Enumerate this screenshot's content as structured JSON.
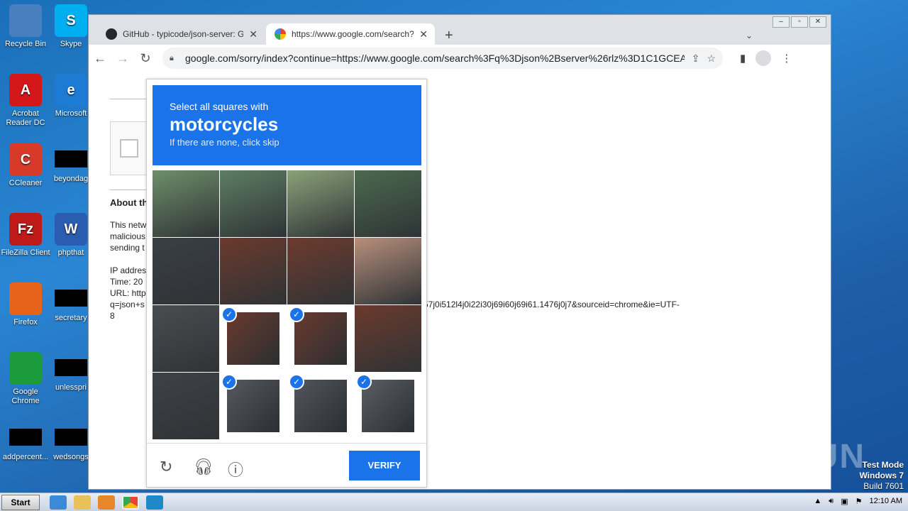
{
  "desktop": {
    "icons": [
      {
        "label": "Recycle Bin",
        "color": "#4a7fbf",
        "glyph": ""
      },
      {
        "label": "Skype",
        "color": "#00aff0",
        "glyph": "S"
      },
      {
        "label": "Acrobat Reader DC",
        "color": "#d4181a",
        "glyph": "A"
      },
      {
        "label": "Microsoft",
        "color": "#1e7bd4",
        "glyph": "e"
      },
      {
        "label": "CCleaner",
        "color": "#d83a2a",
        "glyph": "C"
      },
      {
        "label": "beyondag",
        "color": "#000000",
        "glyph": ""
      },
      {
        "label": "FileZilla Client",
        "color": "#bf1a1a",
        "glyph": "Fz"
      },
      {
        "label": "phpthat",
        "color": "#2a5db0",
        "glyph": "W"
      },
      {
        "label": "Firefox",
        "color": "#e8631a",
        "glyph": ""
      },
      {
        "label": "secretary",
        "color": "#000000",
        "glyph": ""
      },
      {
        "label": "Google Chrome",
        "color": "#1a9a3a",
        "glyph": ""
      },
      {
        "label": "unlesspri",
        "color": "#000000",
        "glyph": ""
      },
      {
        "label": "addpercent...",
        "color": "#000000",
        "glyph": ""
      },
      {
        "label": "wedsongs",
        "color": "#000000",
        "glyph": ""
      }
    ]
  },
  "browser": {
    "tabs": [
      {
        "title": "GitHub - typicode/json-server: Get a",
        "active": false
      },
      {
        "title": "https://www.google.com/search?q=",
        "active": true
      }
    ],
    "url": "google.com/sorry/index?continue=https://www.google.com/search%3Fq%3Djson%2Bserver%26rlz%3D1C1GCEA..."
  },
  "page": {
    "about_heading": "About th",
    "para1_l1": "This netw",
    "para1_l2": "malicious",
    "para1_l3": "sending t",
    "ip": "IP addres",
    "time": "Time: 20",
    "url_line": "URL: http",
    "query_prefix": "q=json+s",
    "query_suffix": "57j0i512l4j0i22i30j69i60j69i61.1476j0j7&sourceid=chrome&ie=UTF-",
    "query_end": "8"
  },
  "captcha": {
    "line1": "Select all squares with",
    "target": "motorcycles",
    "line3": "If there are none, click skip",
    "verify_label": "VERIFY",
    "tiles": [
      {
        "selected": false
      },
      {
        "selected": false
      },
      {
        "selected": false
      },
      {
        "selected": false
      },
      {
        "selected": false
      },
      {
        "selected": false
      },
      {
        "selected": false
      },
      {
        "selected": false
      },
      {
        "selected": false
      },
      {
        "selected": true
      },
      {
        "selected": true
      },
      {
        "selected": false
      },
      {
        "selected": false
      },
      {
        "selected": true
      },
      {
        "selected": true
      },
      {
        "selected": true
      }
    ]
  },
  "taskbar": {
    "start_label": "Start",
    "clock": "12:10 AM"
  },
  "overlay": {
    "watermark": "ANY RUN",
    "testmode_l1": "Test Mode",
    "testmode_l2": "Windows 7",
    "testmode_l3": "Build 7601"
  }
}
